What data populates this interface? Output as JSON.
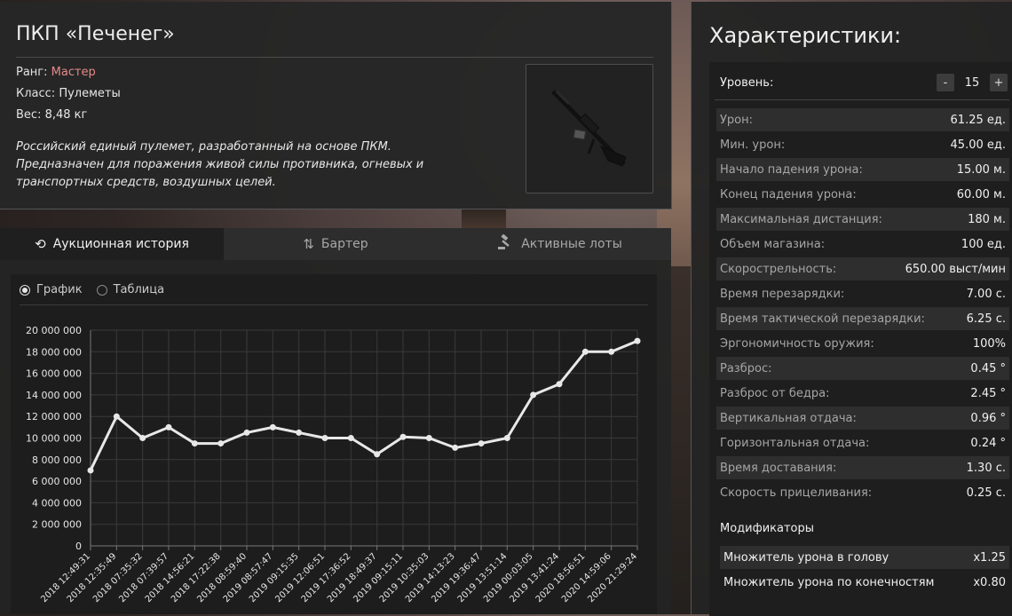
{
  "item": {
    "title": "ПКП «Печенег»",
    "rank_label": "Ранг:",
    "rank_value": "Мастер",
    "class_label": "Класс:",
    "class_value": "Пулеметы",
    "weight_label": "Вес:",
    "weight_value": "8,48 кг",
    "description": "Российский единый пулемет, разработанный на основе ПКМ. Предназначен для поражения живой силы противника, огневых и транспортных средств, воздушных целей."
  },
  "tabs": [
    {
      "label": "Аукционная история",
      "icon": "history-icon"
    },
    {
      "label": "Бартер",
      "icon": "swap-arrows-icon"
    },
    {
      "label": "Активные лоты",
      "icon": "gavel-icon"
    }
  ],
  "view_options": {
    "chart_label": "График",
    "table_label": "Таблица",
    "selected": "chart"
  },
  "chart_data": {
    "type": "line",
    "title": "",
    "xlabel": "",
    "ylabel": "",
    "ylim": [
      0,
      20000000
    ],
    "y_ticks": [
      "0",
      "2 000 000",
      "4 000 000",
      "6 000 000",
      "8 000 000",
      "10 000 000",
      "12 000 000",
      "14 000 000",
      "16 000 000",
      "18 000 000",
      "20 000 000"
    ],
    "x": [
      "2018 12:49:31",
      "2018 12:35:49",
      "2018 07:35:32",
      "2018 07:39:57",
      "2018 14:56:21",
      "2018 17:22:38",
      "2018 08:59:40",
      "2019 08:57:47",
      "2019 09:15:35",
      "2019 12:06:51",
      "2019 17:36:52",
      "2019 18:49:37",
      "2019 09:15:11",
      "2019 10:35:03",
      "2019 14:13:23",
      "2019 19:36:47",
      "2019 13:51:14",
      "2019 00:03:05",
      "2019 13:41:24",
      "2020 18:56:51",
      "2020 14:59:06",
      "2020 21:29:24"
    ],
    "values": [
      7000000,
      12000000,
      10000000,
      11000000,
      9500000,
      9500000,
      10500000,
      11000000,
      10500000,
      10000000,
      10000000,
      8500000,
      10100000,
      10000000,
      9100000,
      9500000,
      10000000,
      14000000,
      15000000,
      18000000,
      18000000,
      19000000
    ],
    "grid": true,
    "line_color": "#e8e8e8"
  },
  "stats": {
    "title": "Характеристики:",
    "level_label": "Уровень:",
    "level_minus": "-",
    "level_value": "15",
    "level_plus": "+",
    "rows": [
      {
        "name": "Урон:",
        "value": "61.25 ед."
      },
      {
        "name": "Мин. урон:",
        "value": "45.00 ед."
      },
      {
        "name": "Начало падения урона:",
        "value": "15.00 м."
      },
      {
        "name": "Конец падения урона:",
        "value": "60.00 м."
      },
      {
        "name": "Максимальная дистанция:",
        "value": "180 м."
      },
      {
        "name": "Объем магазина:",
        "value": "100 ед."
      },
      {
        "name": "Скорострельность:",
        "value": "650.00 выст/мин"
      },
      {
        "name": "Время перезарядки:",
        "value": "7.00 с."
      },
      {
        "name": "Время тактической перезарядки:",
        "value": "6.25 с."
      },
      {
        "name": "Эргономичность оружия:",
        "value": "100%"
      },
      {
        "name": "Разброс:",
        "value": "0.45 °"
      },
      {
        "name": "Разброс от бедра:",
        "value": "2.45 °"
      },
      {
        "name": "Вертикальная отдача:",
        "value": "0.96 °"
      },
      {
        "name": "Горизонтальная отдача:",
        "value": "0.24 °"
      },
      {
        "name": "Время доставания:",
        "value": "1.30 с."
      },
      {
        "name": "Скорость прицеливания:",
        "value": "0.25 с."
      }
    ],
    "mods_title": "Модификаторы",
    "mods": [
      {
        "name": "Множитель урона в голову",
        "value": "x1.25"
      },
      {
        "name": "Множитель урона по конечностям",
        "value": "x0.80"
      }
    ]
  }
}
